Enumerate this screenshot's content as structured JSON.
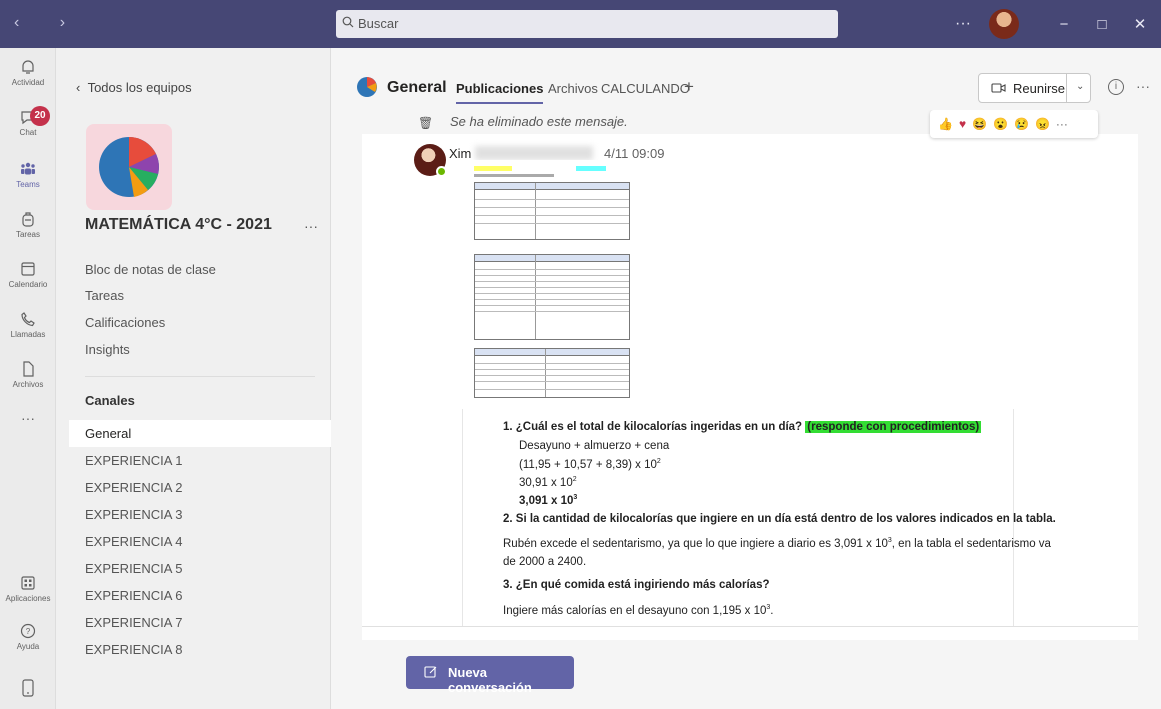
{
  "titlebar": {
    "search_placeholder": "Buscar",
    "more": "···",
    "minimize": "−",
    "maximize": "□",
    "close": "✕"
  },
  "rail": {
    "actividad": "Actividad",
    "chat": "Chat",
    "chat_badge": "20",
    "teams": "Teams",
    "tareas": "Tareas",
    "calendario": "Calendario",
    "llamadas": "Llamadas",
    "archivos": "Archivos",
    "more": "···",
    "aplicaciones": "Aplicaciones",
    "ayuda": "Ayuda"
  },
  "team_panel": {
    "back": "Todos los equipos",
    "team_name": "MATEMÁTICA 4°C - 2021",
    "team_more": "···",
    "links": [
      "Bloc de notas de clase",
      "Tareas",
      "Calificaciones",
      "Insights"
    ],
    "channels_header": "Canales",
    "channels": [
      "General",
      "EXPERIENCIA 1",
      "EXPERIENCIA 2",
      "EXPERIENCIA 3",
      "EXPERIENCIA 4",
      "EXPERIENCIA 5",
      "EXPERIENCIA 6",
      "EXPERIENCIA 7",
      "EXPERIENCIA 8"
    ]
  },
  "header": {
    "channel": "General",
    "tabs": [
      "Publicaciones",
      "Archivos",
      "CALCULANDO"
    ],
    "add_tab": "+",
    "meet": "Reunirse",
    "more": "···"
  },
  "feed": {
    "deleted_message": "Se ha eliminado este mensaje.",
    "reactions": [
      "👍",
      "♥",
      "😆",
      "😮",
      "😢",
      "😠"
    ],
    "reactions_more": "···",
    "author": "Xim",
    "timestamp": "4/11 09:09"
  },
  "work": {
    "q1": "1.  ¿Cuál es el total de kilocalorías ingeridas en un día?",
    "q1_note": "(responde con procedimientos)",
    "l1": "Desayuno + almuerzo + cena",
    "l2": "(11,95 + 10,57 + 8,39) x 10",
    "l3": "30,91 x 10",
    "l4": "3,091 x 10",
    "exp2": "2",
    "exp3": "3",
    "q2": "2.  Si la cantidad de kilocalorías que ingiere en un día está dentro de los valores indicados en la tabla.",
    "a2_line1": "Rubén excede el sedentarismo, ya que lo que ingiere a diario es 3,091 x 10",
    "a2_line1_end": ", en la tabla el sedentarismo va",
    "a2_line2": "de 2000 a 2400.",
    "q3": "3.  ¿En qué comida está ingiriendo más calorías?",
    "a3": "Ingiere más calorías en el desayuno con 1,195 x 10",
    "a3_end": "."
  },
  "new_conversation": "Nueva conversación",
  "colors": {
    "titlebar": "#464775",
    "accent": "#6264a7",
    "badge": "#c4314b",
    "highlight_green": "#33dd33"
  }
}
